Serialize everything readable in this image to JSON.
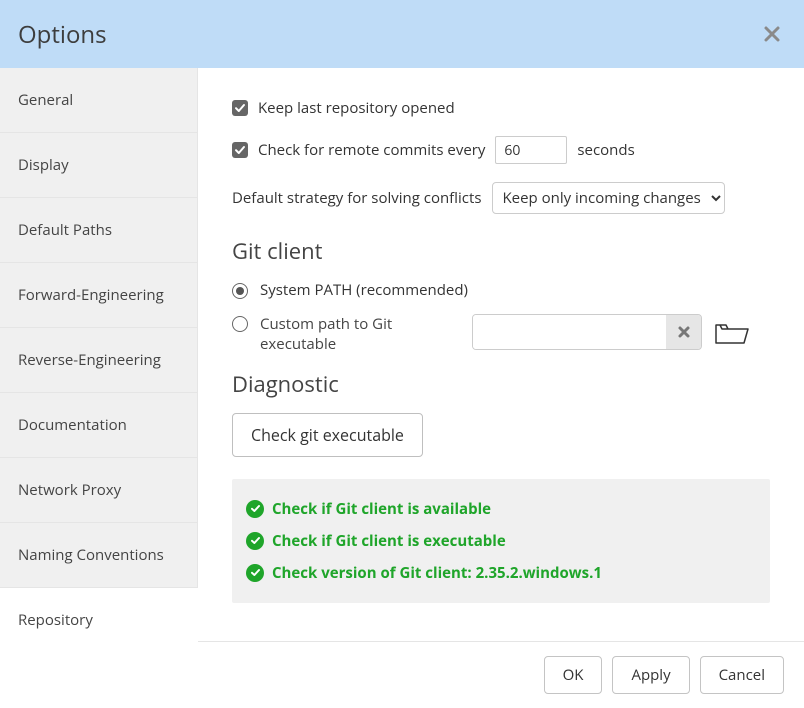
{
  "header": {
    "title": "Options"
  },
  "sidebar": {
    "items": [
      {
        "label": "General"
      },
      {
        "label": "Display"
      },
      {
        "label": "Default Paths"
      },
      {
        "label": "Forward-Engineering"
      },
      {
        "label": "Reverse-Engineering"
      },
      {
        "label": "Documentation"
      },
      {
        "label": "Network Proxy"
      },
      {
        "label": "Naming Conventions"
      },
      {
        "label": "Repository"
      }
    ],
    "active_index": 8
  },
  "content": {
    "keep_last_label": "Keep last repository opened",
    "keep_last_checked": true,
    "check_remote_label_pre": "Check for remote commits every",
    "check_remote_value": "60",
    "check_remote_label_post": "seconds",
    "check_remote_checked": true,
    "conflict_label": "Default strategy for solving conflicts",
    "conflict_selected": "Keep only incoming changes",
    "git_client_heading": "Git client",
    "git_radio_system": "System PATH (recommended)",
    "git_radio_custom": "Custom path to Git executable",
    "git_radio_selected": "system",
    "custom_path_value": "",
    "diagnostic_heading": "Diagnostic",
    "check_exec_button": "Check git executable",
    "diag_lines": [
      "Check if Git client is available",
      "Check if Git client is executable",
      "Check version of Git client: 2.35.2.windows.1"
    ]
  },
  "footer": {
    "ok": "OK",
    "apply": "Apply",
    "cancel": "Cancel"
  }
}
